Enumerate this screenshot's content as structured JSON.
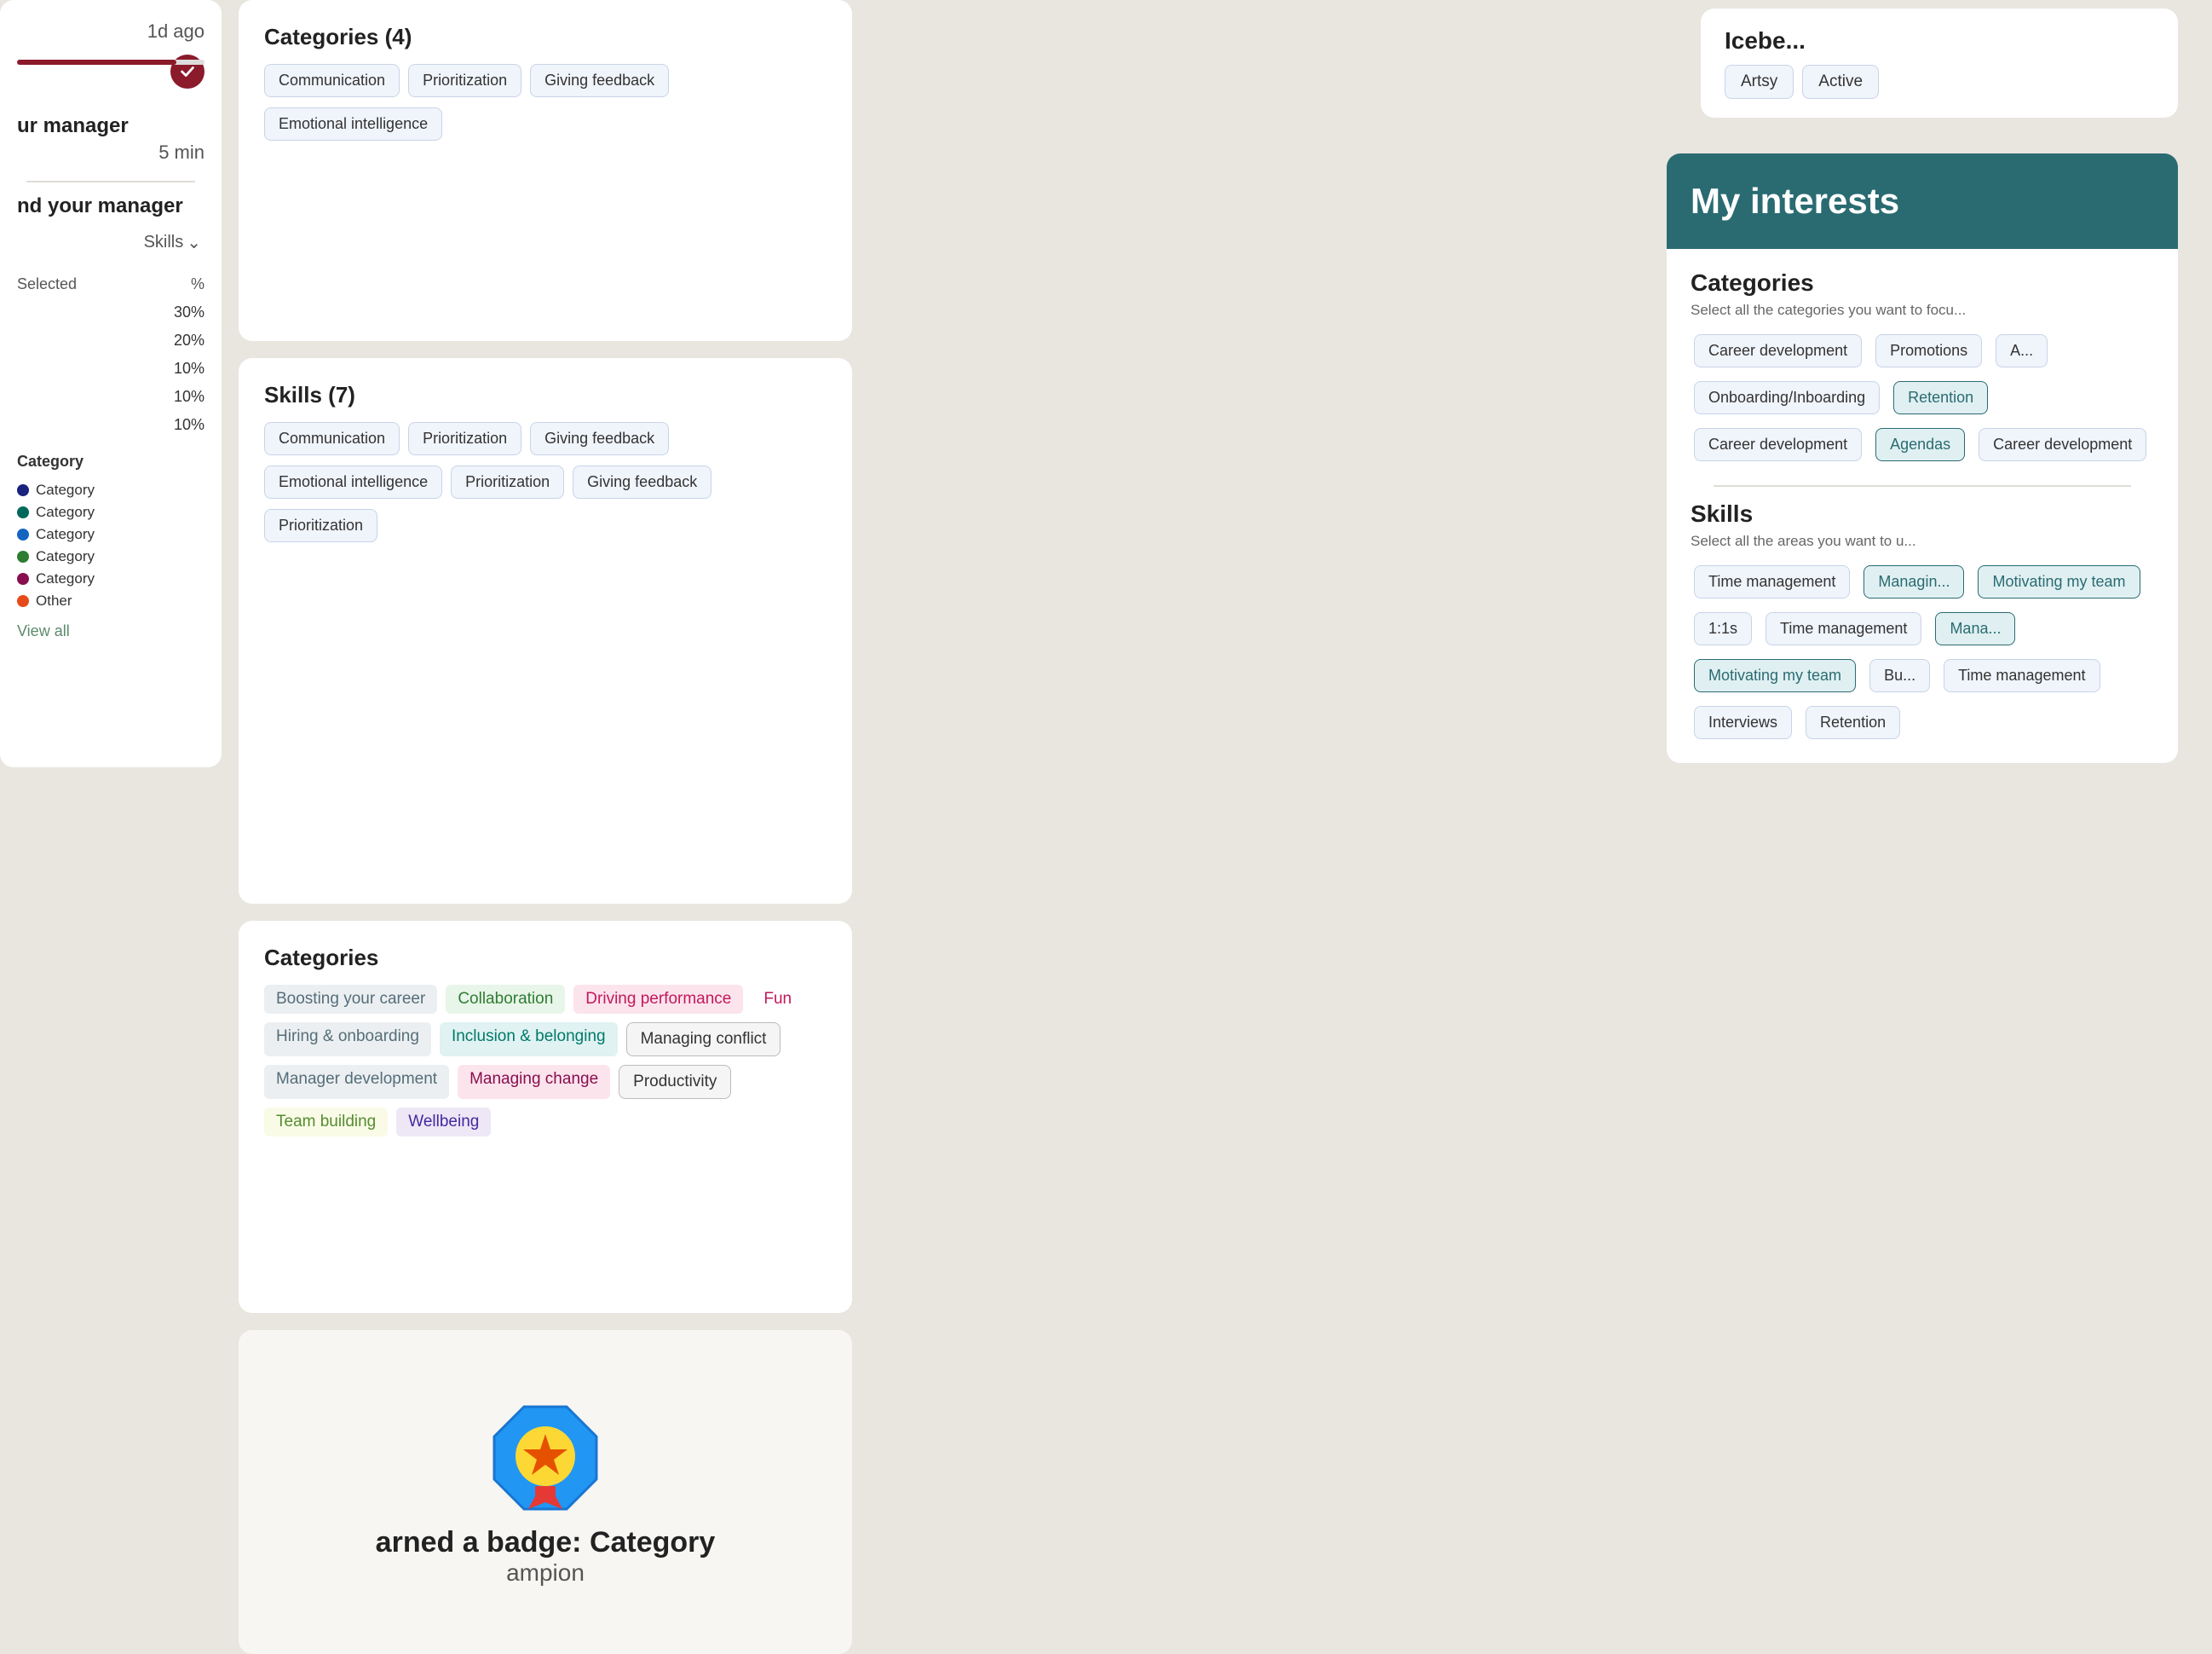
{
  "left_panel": {
    "time_ago": "1d ago",
    "five_min": "5 min",
    "manager_label": "ur manager",
    "manager_label2": "nd your manager",
    "skills_filter": "Skills",
    "selected_label": "Selected",
    "pct_label": "%",
    "rows": [
      {
        "pct": "30%"
      },
      {
        "pct": "20%"
      },
      {
        "pct": "10%"
      },
      {
        "pct": "10%"
      },
      {
        "pct": "10%"
      }
    ],
    "category_title": "Category",
    "legend": [
      {
        "label": "Category",
        "color": "#1a237e"
      },
      {
        "label": "Category",
        "color": "#00695c"
      },
      {
        "label": "Category",
        "color": "#1565c0"
      },
      {
        "label": "Category",
        "color": "#2e7d32"
      },
      {
        "label": "Category",
        "color": "#880e4f"
      },
      {
        "label": "Other",
        "color": "#e64a19"
      }
    ],
    "view_all": "View all"
  },
  "mid_top": {
    "title": "Categories (4)",
    "tags_row1": [
      "Communication",
      "Prioritization",
      "Giving feedback"
    ],
    "tags_row2": [
      "Emotional intelligence"
    ]
  },
  "mid_skills": {
    "title": "Skills (7)",
    "tags_row1": [
      "Communication",
      "Prioritization",
      "Giving feedback"
    ],
    "tags_row2": [
      "Emotional intelligence",
      "Prioritization",
      "Giving feedback"
    ],
    "tags_row3": [
      "Prioritization"
    ]
  },
  "mid_categories": {
    "title": "Categories",
    "tags": [
      {
        "label": "Boosting your career",
        "style": "gray"
      },
      {
        "label": "Collaboration",
        "style": "green"
      },
      {
        "label": "Driving performance",
        "style": "pink"
      },
      {
        "label": "Fun",
        "style": "pink_light"
      },
      {
        "label": "Hiring & onboarding",
        "style": "gray"
      },
      {
        "label": "Inclusion & belonging",
        "style": "teal"
      },
      {
        "label": "Managing conflict",
        "style": "gray_border"
      },
      {
        "label": "Manager development",
        "style": "gray"
      },
      {
        "label": "Managing change",
        "style": "maroon"
      },
      {
        "label": "Productivity",
        "style": "gray_border2"
      },
      {
        "label": "Team building",
        "style": "olive"
      },
      {
        "label": "Wellbeing",
        "style": "lavender"
      }
    ]
  },
  "badge": {
    "title": "arned a badge: Category",
    "subtitle": "ampion"
  },
  "iceberg": {
    "title": "Icebe...",
    "tags": [
      "Artsy",
      "Active"
    ]
  },
  "interests": {
    "header_title": "My interests",
    "categories_section": {
      "title": "Categories",
      "subtitle": "Select all the categories you want to focu...",
      "tags": [
        {
          "label": "Career development",
          "selected": false
        },
        {
          "label": "Promotions",
          "selected": false
        },
        {
          "label": "A...",
          "selected": false
        },
        {
          "label": "Onboarding/Inboarding",
          "selected": false
        },
        {
          "label": "Retention",
          "selected": true
        },
        {
          "label": "Career development",
          "selected": false
        },
        {
          "label": "Agendas",
          "selected": true
        },
        {
          "label": "Career development",
          "selected": false
        }
      ]
    },
    "skills_section": {
      "title": "Skills",
      "subtitle": "Select all the areas you want to u...",
      "tags": [
        {
          "label": "Time management",
          "selected": false
        },
        {
          "label": "Managin...",
          "selected": true
        },
        {
          "label": "Motivating my team",
          "selected": true
        },
        {
          "label": "1:1s",
          "selected": false
        },
        {
          "label": "Time management",
          "selected": false
        },
        {
          "label": "Mana...",
          "selected": true
        },
        {
          "label": "Motivating my team",
          "selected": true
        },
        {
          "label": "Bu...",
          "selected": false
        },
        {
          "label": "Time management",
          "selected": false
        },
        {
          "label": "Interviews",
          "selected": false
        },
        {
          "label": "Retention",
          "selected": false
        }
      ]
    }
  }
}
